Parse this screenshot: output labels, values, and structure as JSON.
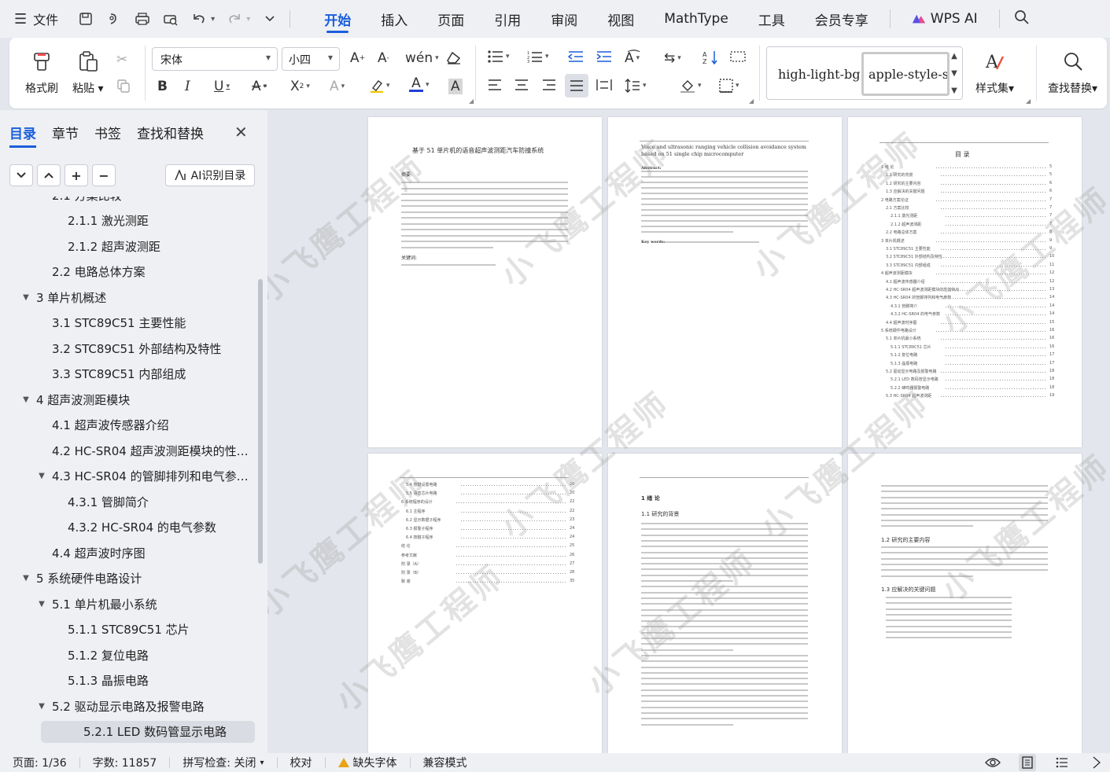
{
  "menu": {
    "file_label": "文件",
    "tabs": [
      "开始",
      "插入",
      "页面",
      "引用",
      "审阅",
      "视图",
      "MathType",
      "工具",
      "会员专享"
    ],
    "active_tab": "开始",
    "wps_ai_label": "WPS AI"
  },
  "ribbon": {
    "format_painter": "格式刷",
    "paste": "粘贴",
    "font_name": "宋体",
    "font_size": "小四",
    "styles": [
      "high-light-bg",
      "apple-style-span"
    ],
    "style_set": "样式集",
    "find_replace": "查找替换"
  },
  "nav": {
    "tabs": [
      "目录",
      "章节",
      "书签",
      "查找和替换"
    ],
    "active_tab": "目录",
    "ai_button": "AI识别目录",
    "items": [
      {
        "label": "2.1 方案比较",
        "level": 2,
        "toggle": ""
      },
      {
        "label": "2.1.1  激光测距",
        "level": 3,
        "toggle": ""
      },
      {
        "label": "2.1.2  超声波测距",
        "level": 3,
        "toggle": ""
      },
      {
        "label": "2.2 电路总体方案",
        "level": 2,
        "toggle": ""
      },
      {
        "label": "3 单片机概述",
        "level": 1,
        "toggle": "▼"
      },
      {
        "label": "3.1 STC89C51 主要性能",
        "level": 2,
        "toggle": ""
      },
      {
        "label": "3.2 STC89C51 外部结构及特性",
        "level": 2,
        "toggle": ""
      },
      {
        "label": "3.3 STC89C51 内部组成",
        "level": 2,
        "toggle": ""
      },
      {
        "label": "4  超声波测距模块",
        "level": 1,
        "toggle": "▼"
      },
      {
        "label": "4.1  超声波传感器介绍",
        "level": 2,
        "toggle": ""
      },
      {
        "label": "4.2 HC-SR04 超声波测距模块的性…",
        "level": 2,
        "toggle": ""
      },
      {
        "label": "4.3 HC-SR04 的管脚排列和电气参…",
        "level": 2,
        "toggle": "▼"
      },
      {
        "label": "4.3.1  管脚简介",
        "level": 3,
        "toggle": ""
      },
      {
        "label": "4.3.2 HC-SR04 的电气参数",
        "level": 3,
        "toggle": ""
      },
      {
        "label": "4.4 超声波时序图",
        "level": 2,
        "toggle": ""
      },
      {
        "label": "5 系统硬件电路设计",
        "level": 1,
        "toggle": "▼"
      },
      {
        "label": "5.1 单片机最小系统",
        "level": 2,
        "toggle": "▼"
      },
      {
        "label": "5.1.1 STC89C51 芯片",
        "level": 3,
        "toggle": ""
      },
      {
        "label": "5.1.2  复位电路",
        "level": 3,
        "toggle": ""
      },
      {
        "label": "5.1.3  晶振电路",
        "level": 3,
        "toggle": ""
      },
      {
        "label": "5.2  驱动显示电路及报警电路",
        "level": 2,
        "toggle": "▼"
      },
      {
        "label": "5.2.1    LED 数码管显示电路",
        "level": 3,
        "toggle": "",
        "selected": true
      }
    ]
  },
  "pages": {
    "p1_title": "基于 51 单片机的语音超声波测距汽车防撞系统",
    "p1_abstract": "摘要:",
    "p1_keywords": "关键词:",
    "p2_title": "Voice and ultrasonic ranging vehicle collision avoidance system based on 51 single chip microcomputer",
    "p2_abstract": "Abstract:",
    "p2_keywords": "Key words:",
    "p3_title": "目 录",
    "p3_toc": [
      "1 绪 论",
      "1.1 研究的背景",
      "1.2 研究的主要内容",
      "1.3 应解决的关键问题",
      "2 电路方案论证",
      "2.1 方案比较",
      "2.1.1 激光测距",
      "2.1.2 超声波测距",
      "2.2 电路总体方案",
      "3 单片机概述",
      "3.1 STC89C51 主要性能",
      "3.2 STC89C51 外部结构及特性",
      "3.3 STC89C51 内部组成",
      "4 超声波测距模块",
      "4.1 超声波传感器介绍",
      "4.2 HC-SR04 超声波测距模块的性能特点",
      "4.3 HC-SR04 的管脚排列和电气参数",
      "4.3.1 管脚简介",
      "4.3.2 HC-SR04 的电气参数",
      "4.4 超声波时序图",
      "5 系统硬件电路设计",
      "5.1 单片机最小系统",
      "5.1.1 STC89C51 芯片",
      "5.1.2 复位电路",
      "5.1.3 晶振电路",
      "5.2 驱动显示电路及报警电路",
      "5.2.1 LED 数码管显示电路",
      "5.2.2 蜂鸣器报警电路",
      "5.3 HC-SR04 超声波测距"
    ],
    "p3_nums": [
      "5",
      "5",
      "6",
      "6",
      "7",
      "7",
      "7",
      "7",
      "8",
      "9",
      "9",
      "10",
      "11",
      "12",
      "12",
      "13",
      "14",
      "14",
      "14",
      "15",
      "16",
      "16",
      "16",
      "17",
      "17",
      "18",
      "18",
      "18",
      "19"
    ],
    "p4_toc": [
      "5.4 按键设置电路",
      "5.5 语音芯片电路",
      "6 系统程序的设计",
      "6.1 主程序",
      "6.2 显示数据子程序",
      "6.3 报警子程序",
      "6.4 按键子程序",
      "结 论",
      "参考文献",
      "附 录（A）",
      "附 录（B）",
      "致 谢"
    ],
    "p4_nums": [
      "20",
      "20",
      "22",
      "22",
      "23",
      "24",
      "24",
      "25",
      "26",
      "27",
      "28",
      "35"
    ],
    "p5_ch": "1  绪  论",
    "p5_sec": "1.1 研究的背景",
    "p6_sec1": "1.2 研究的主要内容",
    "p6_sec2": "1.3 应解决的关键问题",
    "watermark": "小飞鹰工程师"
  },
  "status": {
    "page": "页面: 1/36",
    "words": "字数: 11857",
    "spell": "拼写检查: 关闭",
    "proof": "校对",
    "missing_font": "缺失字体",
    "compat": "兼容模式"
  }
}
